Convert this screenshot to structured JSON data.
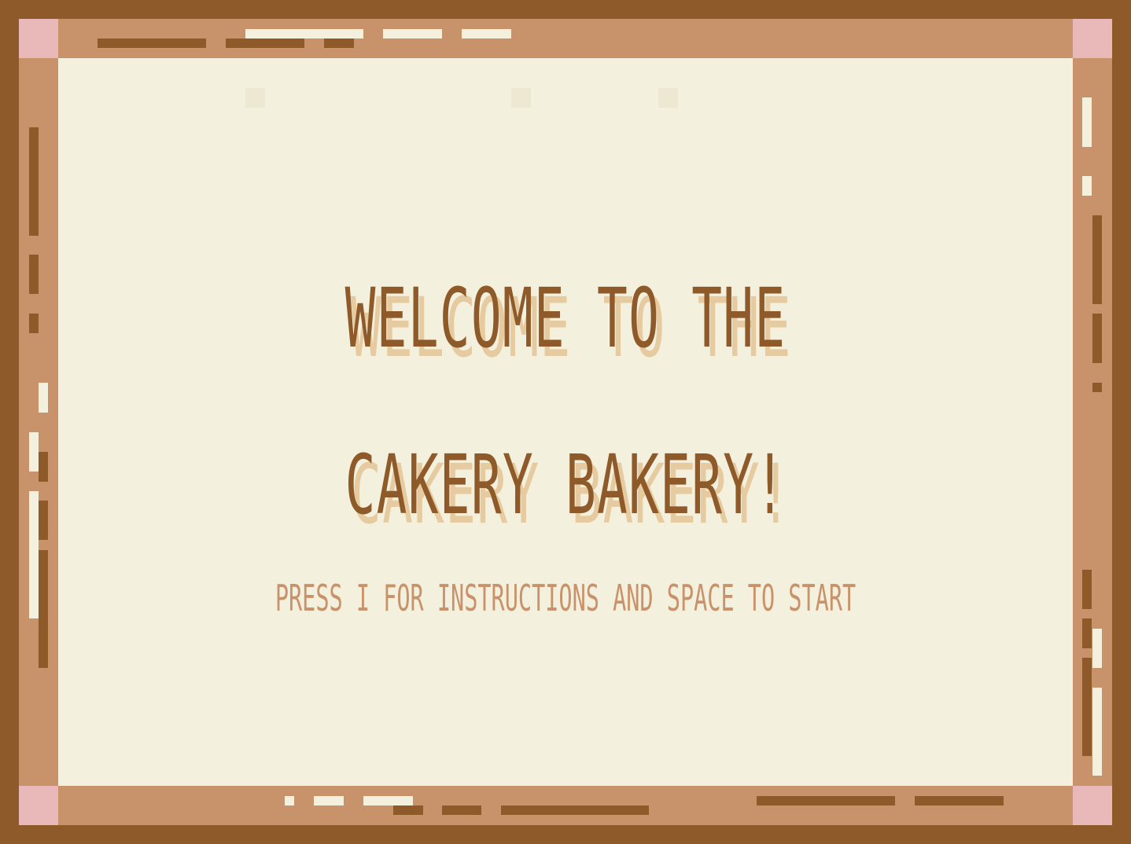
{
  "screen": {
    "title_line1": "WELCOME TO THE",
    "title_line2": "CAKERY BAKERY!",
    "prompt": "PRESS I FOR INSTRUCTIONS AND SPACE TO START"
  },
  "colors": {
    "frame_dark": "#8f5a2a",
    "frame_wood": "#c8926a",
    "corner_pink": "#e8b9b8",
    "panel_cream": "#f4f0de",
    "title_shadow": "#e6caa0"
  }
}
